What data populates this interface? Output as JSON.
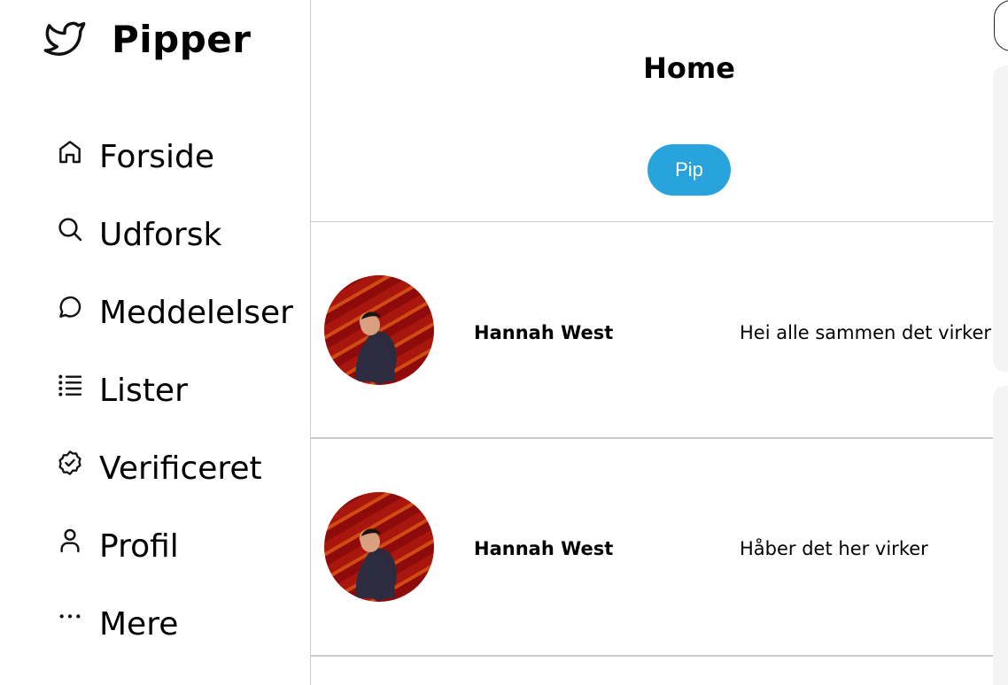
{
  "brand": {
    "name": "Pipper",
    "logo_icon": "bird-icon"
  },
  "nav": [
    {
      "label": "Forside",
      "icon": "home-icon"
    },
    {
      "label": "Udforsk",
      "icon": "search-icon"
    },
    {
      "label": "Meddelelser",
      "icon": "message-icon"
    },
    {
      "label": "Lister",
      "icon": "list-icon"
    },
    {
      "label": "Verificeret",
      "icon": "verified-badge-icon"
    },
    {
      "label": "Profil",
      "icon": "user-icon"
    },
    {
      "label": "Mere",
      "icon": "more-icon"
    }
  ],
  "main": {
    "title": "Home",
    "pip_button_label": "Pip",
    "posts": [
      {
        "author": "Hannah West",
        "text": "Hei alle sammen det virker!"
      },
      {
        "author": "Hannah West",
        "text": "Håber det her virker"
      }
    ]
  },
  "colors": {
    "accent": "#29a3dc",
    "divider": "#c9c9c9",
    "panel": "#f4f4f5"
  }
}
